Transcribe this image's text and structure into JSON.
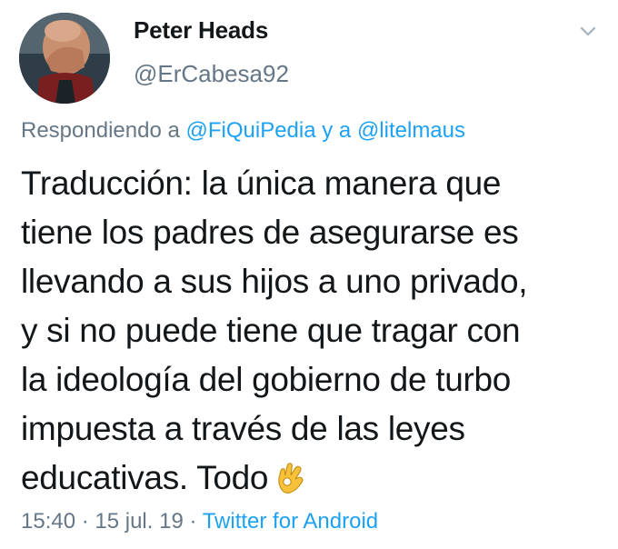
{
  "author": {
    "name": "Peter Heads",
    "handle": "@ErCabesa92"
  },
  "reply_to": {
    "prefix": "Respondiendo a ",
    "mention1": "@FiQuiPedia",
    "joiner": " y a ",
    "mention2": "@litelmaus"
  },
  "body": {
    "lines": [
      "Traducción: la única manera que",
      "tiene los padres de asegurarse es",
      "llevando a sus hijos a uno privado,",
      "y si no puede tiene que tragar con",
      "la ideología del gobierno de turbo",
      "impuesta a través de las leyes",
      "educativas. Todo"
    ],
    "emoji": "ok-hand-icon"
  },
  "meta": {
    "time": "15:40",
    "sep1": " · ",
    "date": "15 jul. 19",
    "sep2": " · ",
    "source": "Twitter for Android"
  },
  "colors": {
    "link": "#1da1f2",
    "secondary": "#657786",
    "primary": "#14171a",
    "emoji": "#f7c23a"
  },
  "icons": [
    "user-avatar",
    "chevron-down-icon",
    "ok-hand-icon"
  ]
}
